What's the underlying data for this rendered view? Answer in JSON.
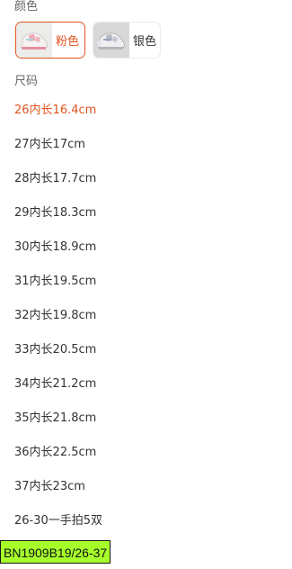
{
  "color_section": {
    "label": "颜色",
    "options": [
      {
        "name": "粉色",
        "selected": true
      },
      {
        "name": "银色",
        "selected": false
      }
    ]
  },
  "size_section": {
    "label": "尺码",
    "options": [
      {
        "name": "26内长16.4cm",
        "selected": true
      },
      {
        "name": "27内长17cm",
        "selected": false
      },
      {
        "name": "28内长17.7cm",
        "selected": false
      },
      {
        "name": "29内长18.3cm",
        "selected": false
      },
      {
        "name": "30内长18.9cm",
        "selected": false
      },
      {
        "name": "31内长19.5cm",
        "selected": false
      },
      {
        "name": "32内长19.8cm",
        "selected": false
      },
      {
        "name": "33内长20.5cm",
        "selected": false
      },
      {
        "name": "34内长21.2cm",
        "selected": false
      },
      {
        "name": "35内长21.8cm",
        "selected": false
      },
      {
        "name": "36内长22.5cm",
        "selected": false
      },
      {
        "name": "37内长23cm",
        "selected": false
      },
      {
        "name": "26-30一手拍5双",
        "selected": false
      }
    ]
  },
  "sku_badge": {
    "text": "BN1909B19/26-37"
  },
  "colors": {
    "accent": "#e0541f",
    "text": "#333333",
    "label": "#666666",
    "badge_background": "#a6ff2b"
  }
}
